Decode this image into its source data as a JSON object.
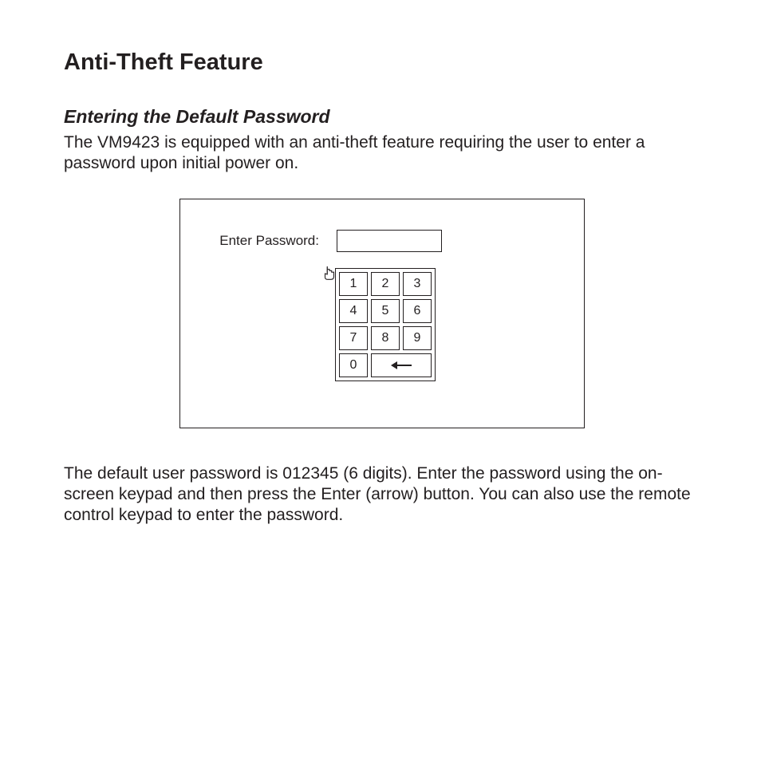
{
  "title": "Anti-Theft Feature",
  "subtitle": "Entering the Default Password",
  "intro": "The VM9423 is equipped with an anti-theft feature requiring the user to enter a password upon initial power on.",
  "screen": {
    "password_label": "Enter Password:",
    "password_value": "",
    "keypad": {
      "row1": [
        "1",
        "2",
        "3"
      ],
      "row2": [
        "4",
        "5",
        "6"
      ],
      "row3": [
        "7",
        "8",
        "9"
      ],
      "row4_zero": "0",
      "enter_icon": "enter-arrow-icon"
    }
  },
  "body": "The default user password is 012345 (6 digits). Enter the password using the on-screen keypad and then press the Enter (arrow) button. You can also use the remote control keypad to enter the password."
}
